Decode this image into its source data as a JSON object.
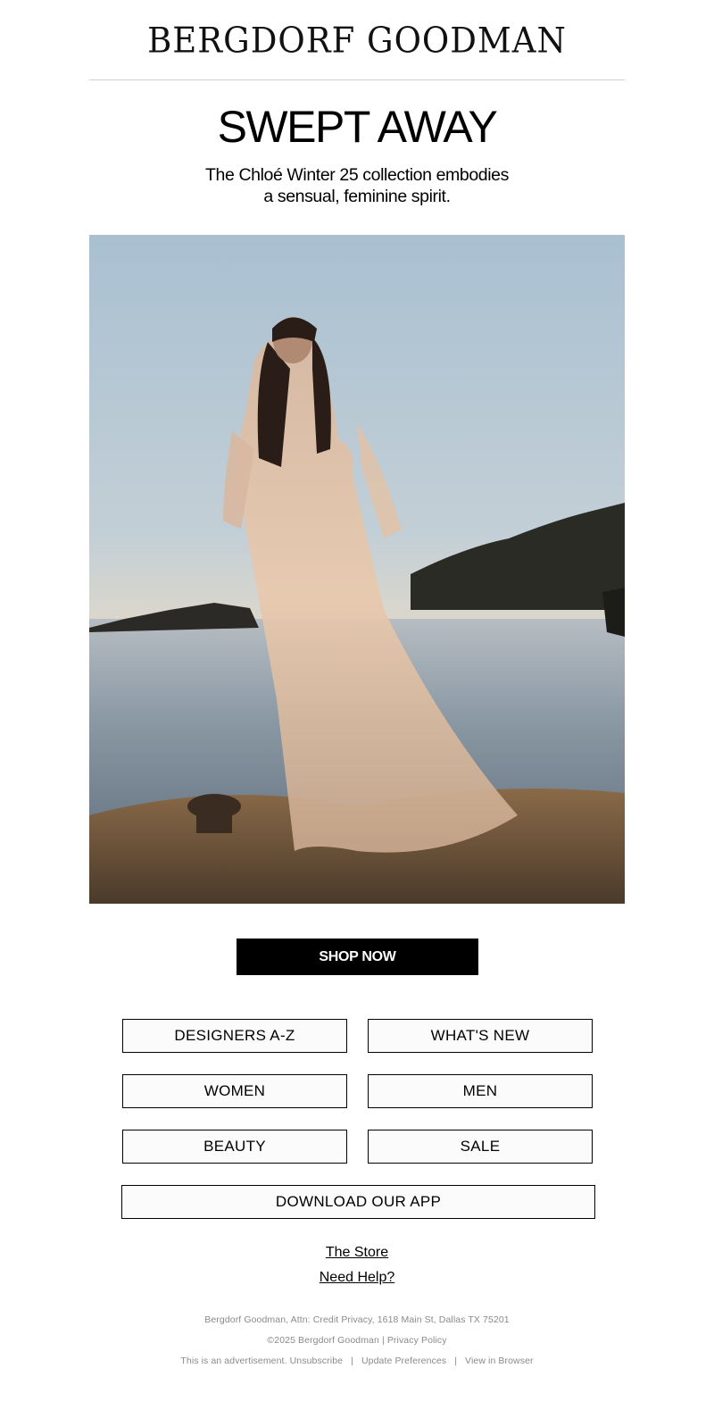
{
  "header": {
    "brand": "BERGDORF GOODMAN"
  },
  "hero": {
    "headline": "SWEPT AWAY",
    "subhead_line1": "The Chloé Winter 25 collection embodies",
    "subhead_line2": "a sensual, feminine spirit."
  },
  "cta": {
    "shop_now": "SHOP NOW"
  },
  "nav": {
    "designers": "DESIGNERS A-Z",
    "whats_new": "WHAT'S NEW",
    "women": "WOMEN",
    "men": "MEN",
    "beauty": "BEAUTY",
    "sale": "SALE",
    "download_app": "DOWNLOAD OUR APP"
  },
  "links": {
    "the_store": "The Store",
    "need_help": "Need Help?"
  },
  "footer": {
    "address": "Bergdorf Goodman, Attn: Credit Privacy, 1618 Main St, Dallas TX 75201",
    "copyright": "©2025 Bergdorf Goodman",
    "privacy": "Privacy Policy",
    "advert": "This is an advertisement.",
    "unsubscribe": "Unsubscribe",
    "preferences": "Update Preferences",
    "view_browser": "View in Browser"
  }
}
